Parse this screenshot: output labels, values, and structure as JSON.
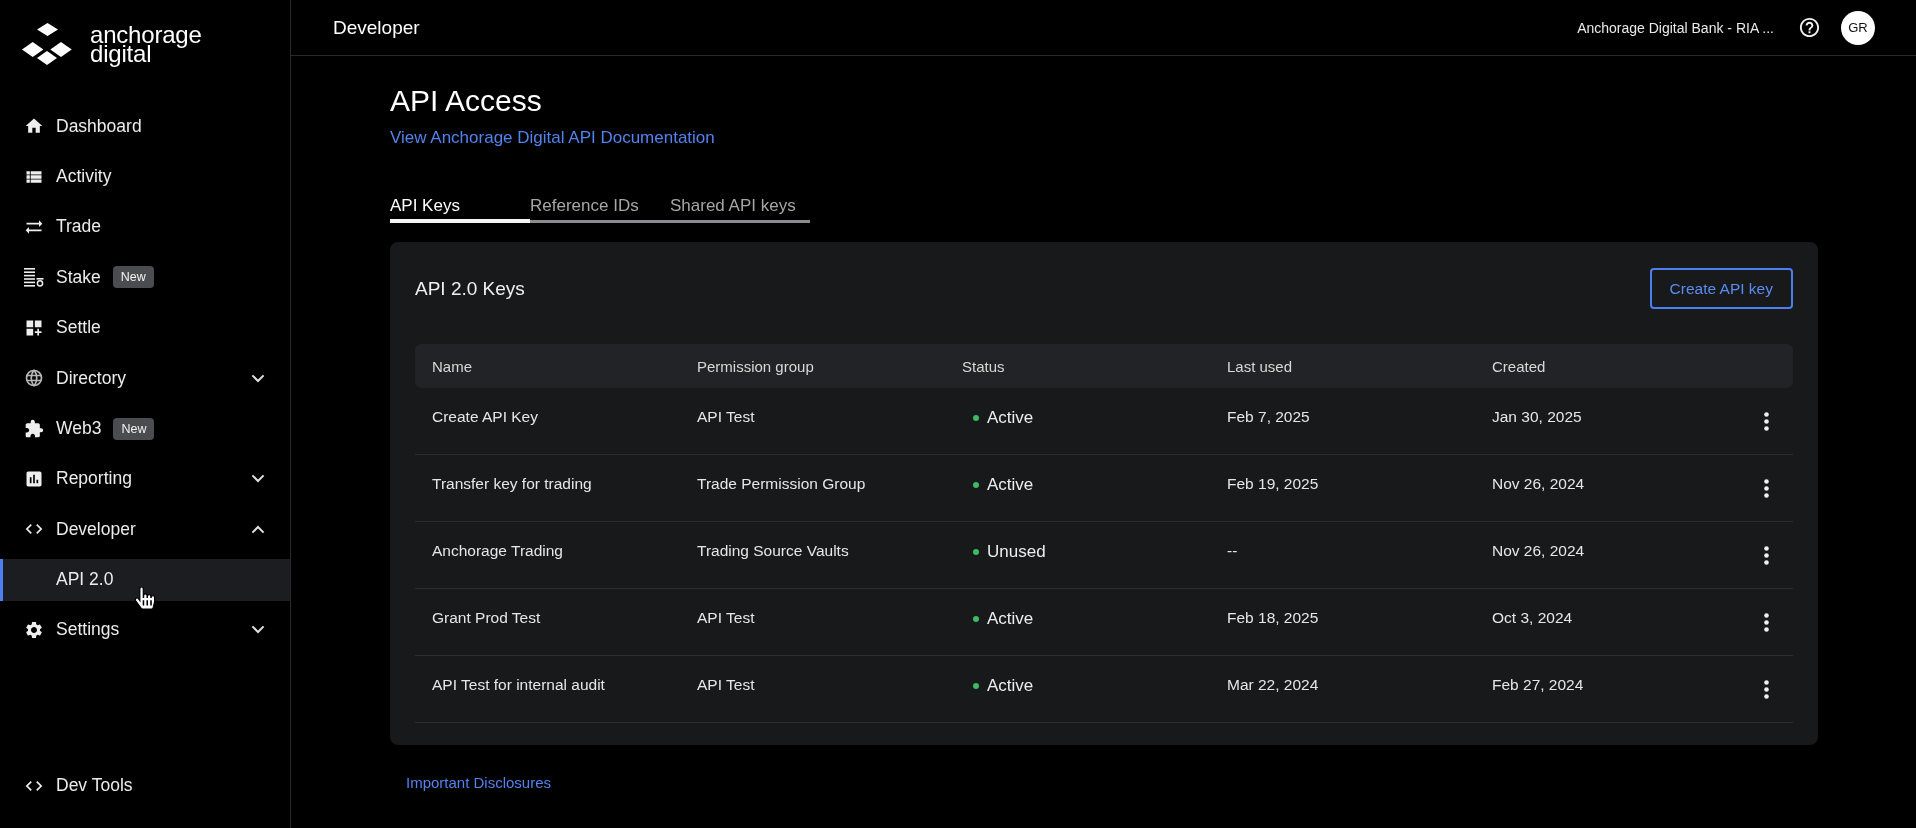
{
  "sidebar": {
    "logo": {
      "lines": [
        "anchorage",
        "digital"
      ]
    },
    "items": [
      {
        "kind": "link",
        "label": "Dashboard",
        "selected": false
      },
      {
        "kind": "link",
        "label": "Activity",
        "selected": false
      },
      {
        "kind": "link",
        "label": "Trade",
        "selected": false
      },
      {
        "kind": "link",
        "label": "Stake",
        "badge": "New",
        "selected": false
      },
      {
        "kind": "link",
        "label": "Settle",
        "selected": false
      },
      {
        "kind": "group",
        "label": "Directory",
        "expanded": false,
        "selected": false
      },
      {
        "kind": "link",
        "label": "Web3",
        "badge": "New",
        "selected": false
      },
      {
        "kind": "group",
        "label": "Reporting",
        "expanded": false,
        "selected": false
      },
      {
        "kind": "group",
        "label": "Developer",
        "expanded": true,
        "selected": false,
        "children": [
          {
            "label": "API 2.0",
            "selected": true
          }
        ]
      },
      {
        "kind": "group",
        "label": "Settings",
        "expanded": false,
        "selected": false
      }
    ],
    "footer_item": {
      "label": "Dev Tools",
      "selected": false
    }
  },
  "header": {
    "title": "Developer",
    "account": "Anchorage Digital Bank - RIA ...",
    "avatar_initials": "GR"
  },
  "page": {
    "title": "API Access",
    "documentation_link": "View Anchorage Digital API Documentation",
    "tabs": [
      {
        "label": "API Keys",
        "selected": true
      },
      {
        "label": "Reference IDs",
        "selected": false
      },
      {
        "label": "Shared API keys",
        "selected": false
      }
    ]
  },
  "keys_card": {
    "title": "API 2.0 Keys",
    "create_button": "Create API key",
    "table": {
      "columns": [
        "Name",
        "Permission group",
        "Status",
        "Last used",
        "Created"
      ],
      "rows": [
        {
          "name": "Create API Key",
          "permission_group": "API Test",
          "status": "Active",
          "last_used": "Feb 7, 2025",
          "created": "Jan 30, 2025"
        },
        {
          "name": "Transfer key for trading",
          "permission_group": "Trade Permission Group",
          "status": "Active",
          "last_used": "Feb 19, 2025",
          "created": "Nov 26, 2024"
        },
        {
          "name": "Anchorage Trading",
          "permission_group": "Trading Source Vaults",
          "status": "Unused",
          "last_used": "--",
          "created": "Nov 26, 2024"
        },
        {
          "name": "Grant Prod Test",
          "permission_group": "API Test",
          "status": "Active",
          "last_used": "Feb 18, 2025",
          "created": "Oct 3, 2024"
        },
        {
          "name": "API Test for internal audit",
          "permission_group": "API Test",
          "status": "Active",
          "last_used": "Mar 22, 2024",
          "created": "Feb 27, 2024"
        }
      ]
    }
  },
  "footer_link": "Important Disclosures"
}
